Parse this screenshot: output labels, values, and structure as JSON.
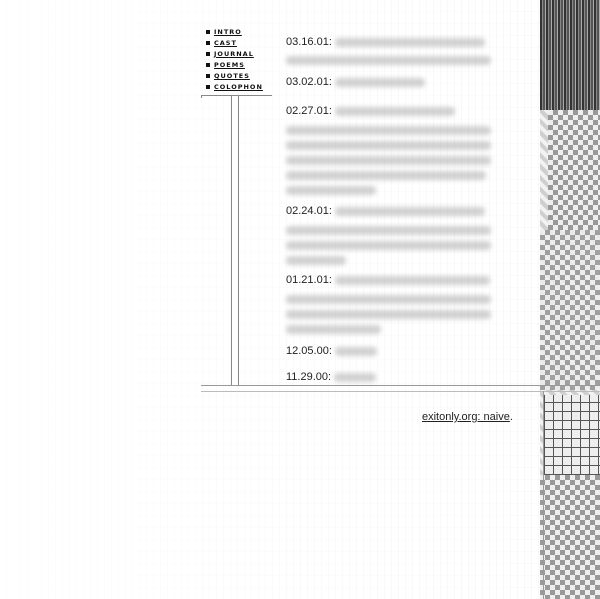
{
  "nav": {
    "items": [
      {
        "label": "INTRO"
      },
      {
        "label": "CAST"
      },
      {
        "label": "JOURNAL"
      },
      {
        "label": "POEMS"
      },
      {
        "label": "QUOTES"
      },
      {
        "label": "COLOPHON"
      }
    ]
  },
  "journal": {
    "entries": [
      {
        "date": "03.16.01:"
      },
      {
        "date": "03.02.01:"
      },
      {
        "date": "02.27.01:"
      },
      {
        "date": "02.24.01:"
      },
      {
        "date": "01.21.01:"
      },
      {
        "date": "12.05.00:"
      },
      {
        "date": "11.29.00:"
      }
    ]
  },
  "footer": {
    "link_text": "exitonly.org: naive",
    "suffix": "."
  }
}
